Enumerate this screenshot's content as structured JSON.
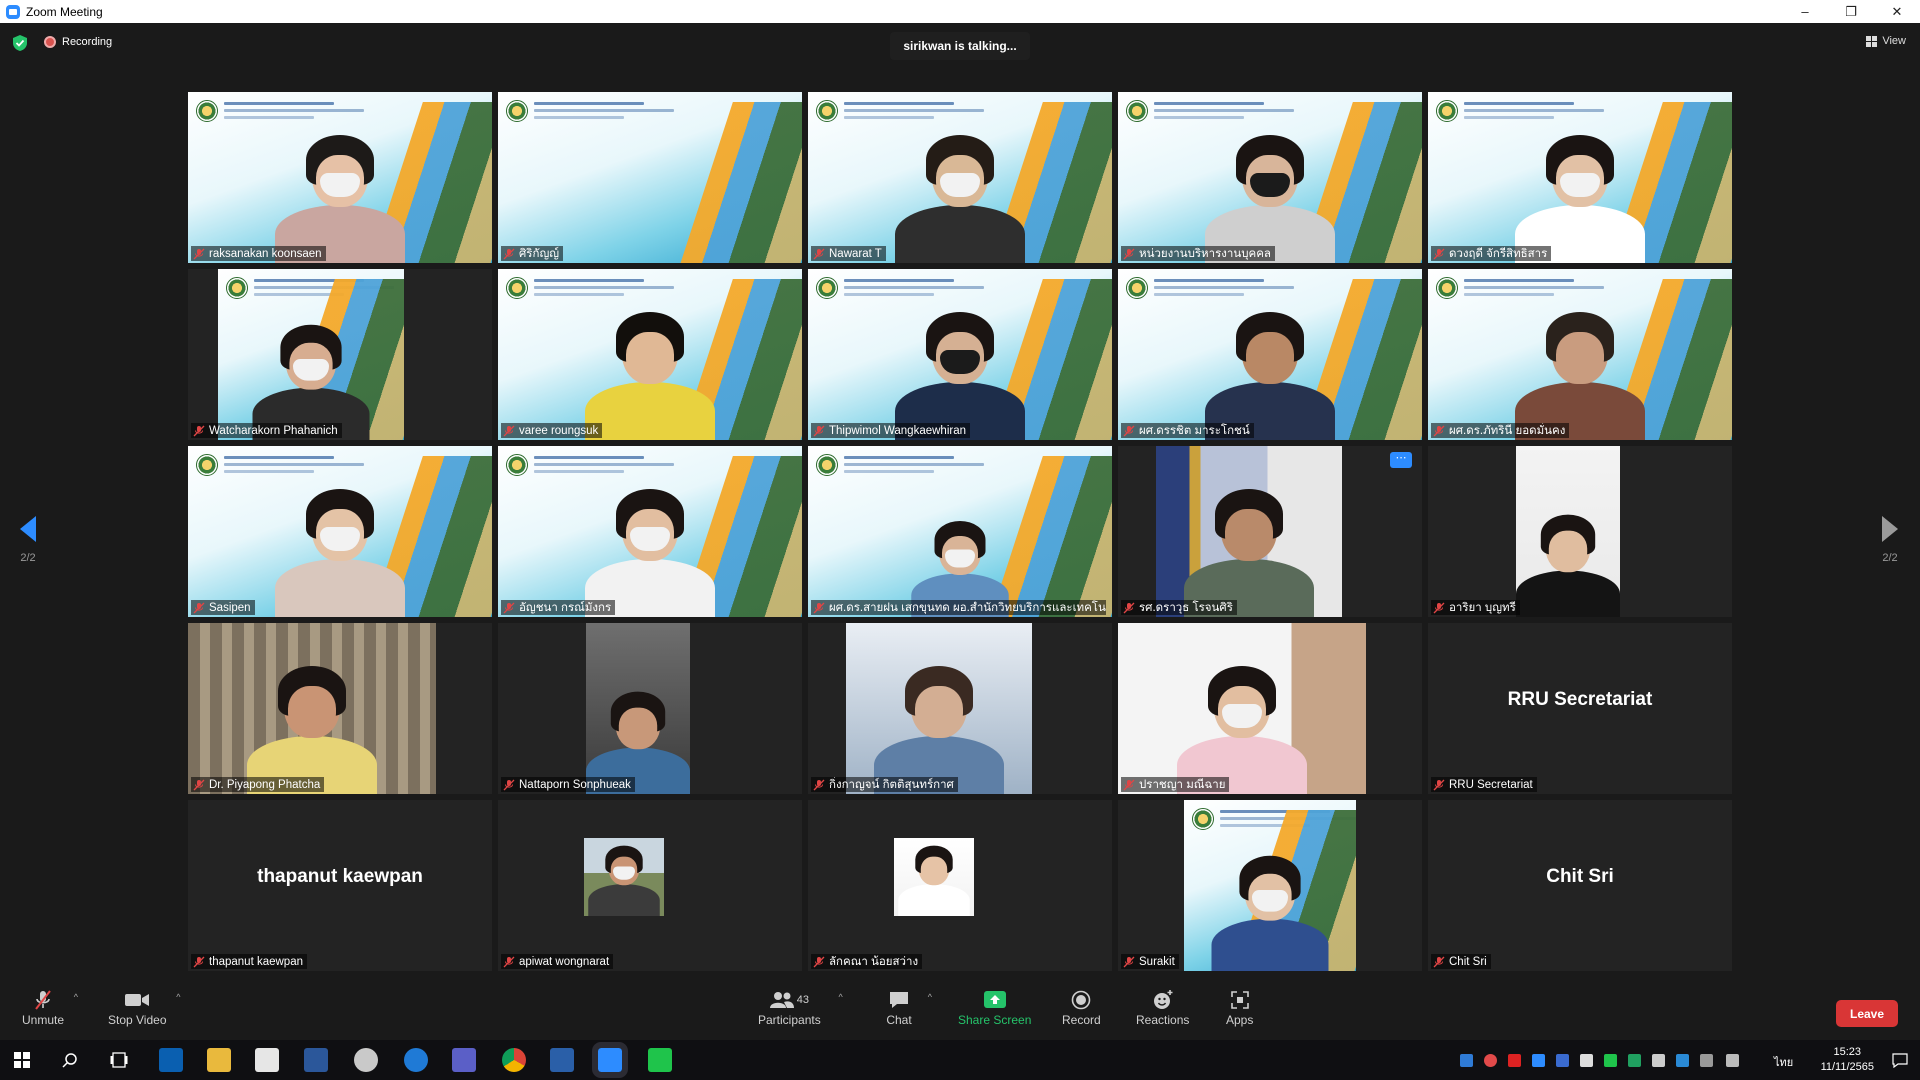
{
  "window": {
    "title": "Zoom Meeting"
  },
  "topbar": {
    "recording_label": "Recording",
    "talking": "sirikwan is talking...",
    "view_label": "View"
  },
  "pager": {
    "left_label": "2/2",
    "right_label": "2/2"
  },
  "participants": [
    {
      "name": "raksanakan koonsaen"
    },
    {
      "name": "ศิริกัญญ์"
    },
    {
      "name": "Nawarat T"
    },
    {
      "name": "หน่วยงานบริหารงานบุคคล"
    },
    {
      "name": "ดวงฤดี จักรีสิทธิสาร"
    },
    {
      "name": "Watcharakorn Phahanich"
    },
    {
      "name": "varee roungsuk"
    },
    {
      "name": "Thipwimol Wangkaewhiran"
    },
    {
      "name": "ผศ.ดรรชิต มาระโกชน์"
    },
    {
      "name": "ผศ.ดร.ภัทรินี ยอดมั่นคง"
    },
    {
      "name": "Sasipen"
    },
    {
      "name": "อัญชนา กรณ์มังกร"
    },
    {
      "name": "ผศ.ดร.สายฝน เสกขุนทด ผอ.สำนักวิทยบริการและเทคโนโลยีสารสนเทศ"
    },
    {
      "name": "รศ.ดราวุธ โรจนศิริ"
    },
    {
      "name": "อาริยา บุญทรี"
    },
    {
      "name": "Dr. Piyapong Phatcha"
    },
    {
      "name": "Nattaporn Sonphueak"
    },
    {
      "name": "กิ่งกาญจน์ กิตติสุนทร์กาศ"
    },
    {
      "name": "ปราชญา มณีฉาย"
    },
    {
      "name": "RRU Secretariat",
      "big": "RRU Secretariat"
    },
    {
      "name": "thapanut kaewpan",
      "big": "thapanut kaewpan"
    },
    {
      "name": "apiwat wongnarat"
    },
    {
      "name": "ลักคณา น้อยสว่าง"
    },
    {
      "name": "Surakit"
    },
    {
      "name": "Chit Sri",
      "big": "Chit Sri"
    }
  ],
  "toolbar": {
    "unmute": "Unmute",
    "stop_video": "Stop Video",
    "participants": "Participants",
    "participants_count": "43",
    "chat": "Chat",
    "share_screen": "Share Screen",
    "record": "Record",
    "reactions": "Reactions",
    "apps": "Apps",
    "leave": "Leave"
  },
  "taskbar": {
    "time": "15:23",
    "date": "11/11/2565",
    "lang": "ไทย"
  },
  "colors": {
    "zoom_blue": "#2D8CFF",
    "leave_red": "#d93636",
    "share_green": "#25c36a",
    "mic_muted_red": "#e04545"
  }
}
